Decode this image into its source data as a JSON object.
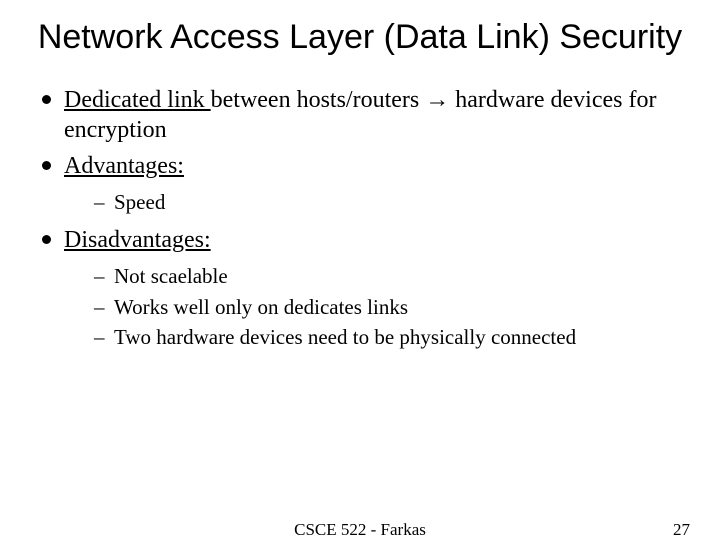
{
  "title": "Network Access Layer (Data Link) Security",
  "bullets": {
    "b1": {
      "underlined": "Dedicated link ",
      "rest_a": "between hosts/routers ",
      "arrow": "→",
      "rest_b": " hardware devices for encryption"
    },
    "b2": {
      "underlined": "Advantages:"
    },
    "b2_sub": {
      "s1": "Speed"
    },
    "b3": {
      "underlined": "Disadvantages:"
    },
    "b3_sub": {
      "s1": "Not scaelable",
      "s2": "Works well only on dedicates links",
      "s3": "Two hardware devices need to be physically connected"
    }
  },
  "footer": {
    "center": "CSCE 522 - Farkas",
    "page": "27"
  }
}
